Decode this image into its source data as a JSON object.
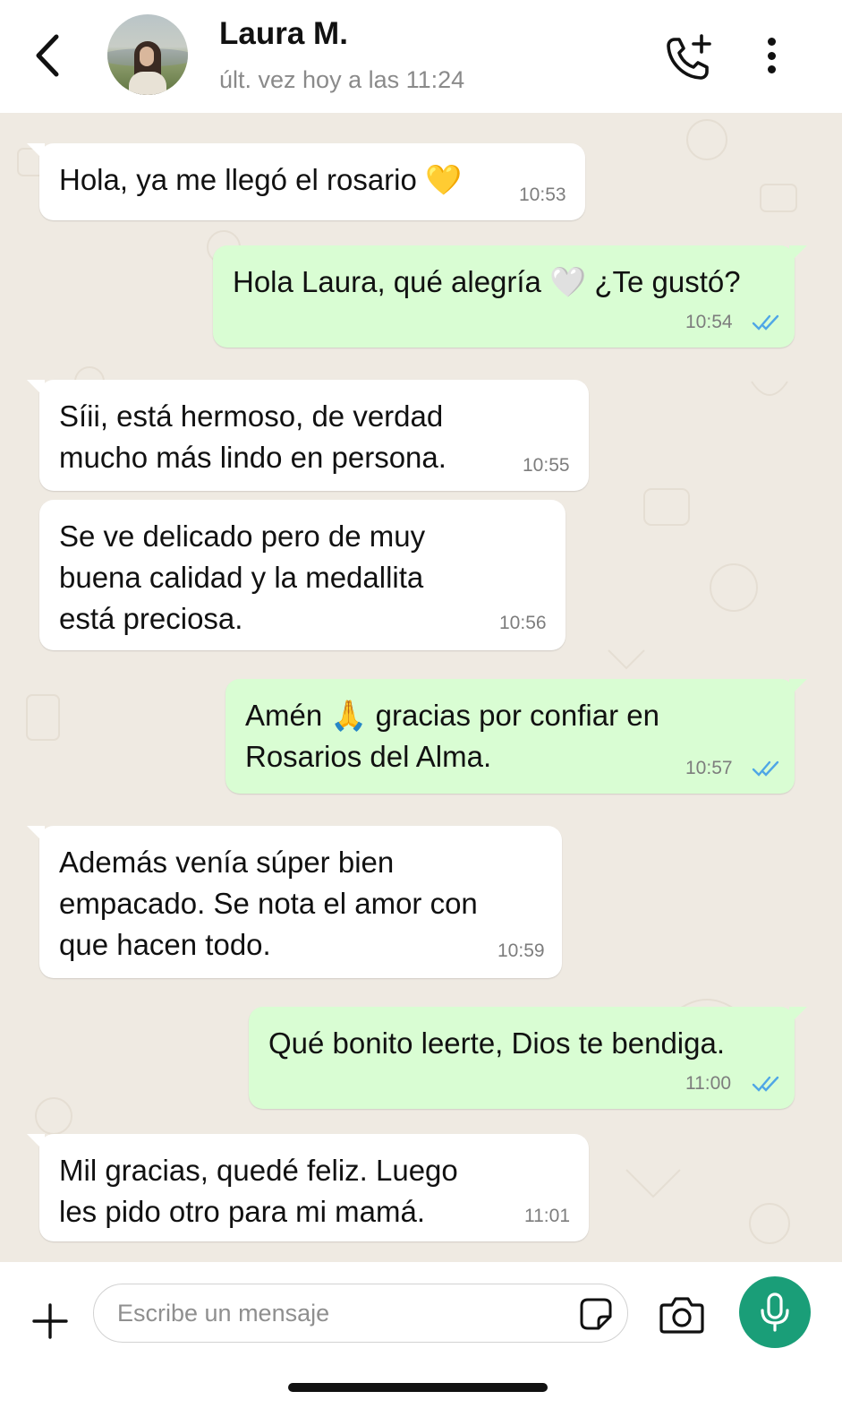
{
  "header": {
    "contact_name": "Laura M.",
    "last_seen": "últ. vez hoy a las 11:24",
    "icons": [
      "back-arrow-icon",
      "avatar",
      "add-call-icon",
      "more-vertical-icon"
    ]
  },
  "messages": [
    {
      "direction": "in",
      "text": "Hola, ya me llegó el rosario 💛",
      "time": "10:53"
    },
    {
      "direction": "out",
      "text": "Hola Laura, qué alegría 🤍 ¿Te gustó?",
      "time": "10:54",
      "read": true
    },
    {
      "direction": "in",
      "text": "Síii, está hermoso, de verdad\nmucho más lindo en persona.",
      "time": "10:55"
    },
    {
      "direction": "in",
      "text": "Se ve delicado pero de muy\nbuena calidad y la medallita\nestá preciosa.",
      "time": "10:56"
    },
    {
      "direction": "out",
      "text": "Amén 🙏 gracias por confiar en\nRosarios del Alma.",
      "time": "10:57",
      "read": true
    },
    {
      "direction": "in",
      "text": "Además venía súper bien\nempacado. Se nota el amor con\nque hacen todo.",
      "time": "10:59"
    },
    {
      "direction": "out",
      "text": "Qué bonito leerte, Dios te bendiga.",
      "time": "11:00",
      "read": true
    },
    {
      "direction": "in",
      "text": "Mil gracias, quedé feliz. Luego\nles pido otro para mi mamá.",
      "time": "11:01"
    }
  ],
  "composer": {
    "placeholder": "Escribe un mensaje",
    "value": ""
  },
  "colors": {
    "incoming_bubble": "#ffffff",
    "outgoing_bubble": "#d9fdd3",
    "chat_background": "#efeae2",
    "read_ticks": "#4fa6e6",
    "mic_button": "#1a9e78"
  }
}
